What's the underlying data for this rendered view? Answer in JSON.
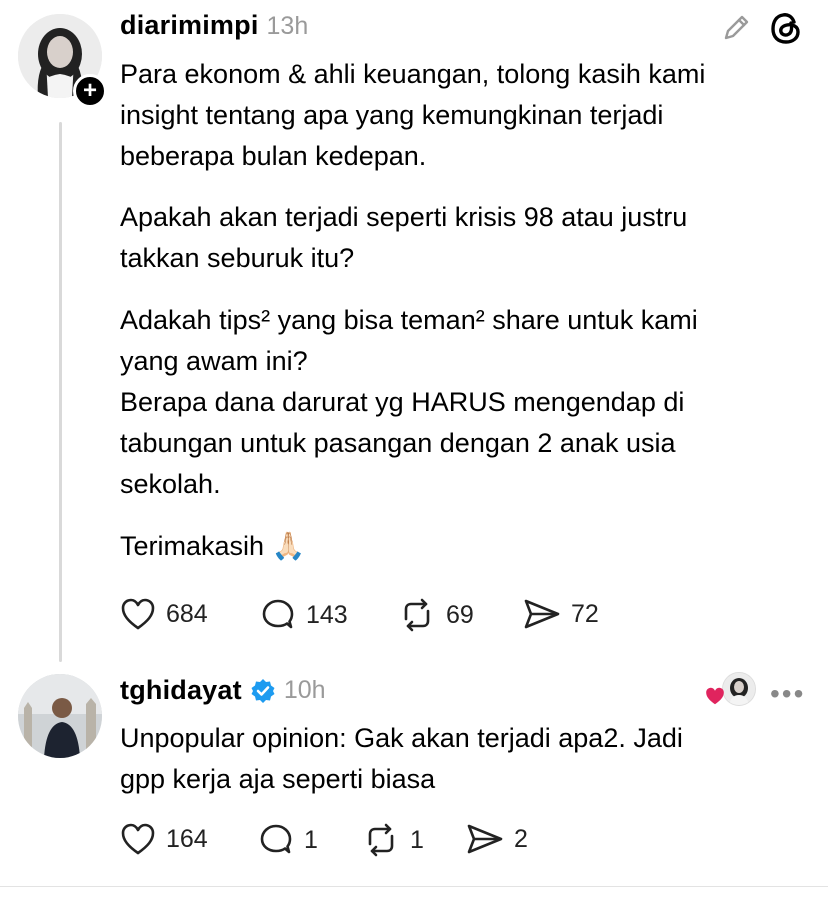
{
  "post": {
    "username": "diarimimpi",
    "time": "13h",
    "paragraphs": [
      [
        "Para ekonom & ahli keuangan, tolong kasih kami",
        "insight tentang apa yang kemungkinan terjadi",
        "beberapa bulan kedepan."
      ],
      [
        "Apakah akan terjadi seperti krisis 98 atau justru",
        "takkan seburuk itu?"
      ],
      [
        "Adakah tips² yang bisa teman² share untuk kami",
        "yang awam ini?",
        "Berapa dana darurat yg HARUS mengendap di",
        "tabungan untuk pasangan dengan 2 anak usia",
        "sekolah."
      ],
      [
        "Terimakasih 🙏🏻"
      ]
    ],
    "likes": "684",
    "replies": "143",
    "reposts": "69",
    "shares": "72"
  },
  "reply": {
    "username": "tghidayat",
    "time": "10h",
    "lines": [
      "Unpopular opinion: Gak akan terjadi apa2. Jadi",
      "gpp kerja aja seperti biasa"
    ],
    "likes": "164",
    "replies": "1",
    "reposts": "1",
    "shares": "2"
  },
  "icons": {
    "edit": "pencil-icon",
    "threads": "threads-logo-icon",
    "like": "heart-icon",
    "comment": "comment-bubble-icon",
    "repost": "repost-icon",
    "share": "send-icon",
    "verified": "verified-badge-icon",
    "more": "more-dots-icon"
  },
  "colors": {
    "verified": "#1d9bf0",
    "liked_heart": "#e0245e",
    "muted": "#9a9a9a"
  }
}
